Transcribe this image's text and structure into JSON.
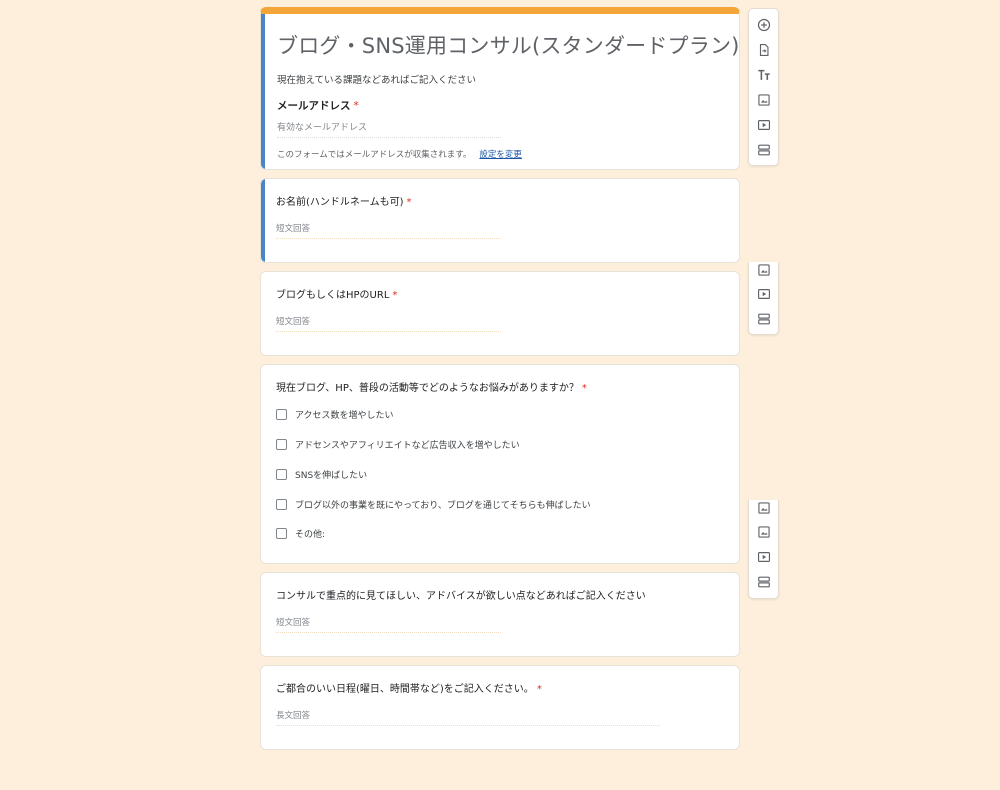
{
  "form": {
    "title": "ブログ・SNS運用コンサル(スタンダードプラン)",
    "description": "現在抱えている課題などあればご記入ください",
    "email_label": "メールアドレス",
    "required_mark": "*",
    "email_placeholder": "有効なメールアドレス",
    "collect_note": "このフォームではメールアドレスが収集されます。",
    "settings_link": "設定を変更"
  },
  "questions": [
    {
      "title": "お名前(ハンドルネームも可)",
      "required": "*",
      "answer_hint": "短文回答"
    },
    {
      "title": "ブログもしくはHPのURL",
      "required": "*",
      "answer_hint": "短文回答"
    },
    {
      "title": "現在ブログ、HP、普段の活動等でどのようなお悩みがありますか？",
      "required": "*",
      "options": [
        "アクセス数を増やしたい",
        "アドセンスやアフィリエイトなど広告収入を増やしたい",
        "SNSを伸ばしたい",
        "ブログ以外の事業を既にやっており、ブログを通じてそちらも伸ばしたい",
        "その他:"
      ]
    },
    {
      "title": "コンサルで重点的に見てほしい、アドバイスが欲しい点などあればご記入ください",
      "answer_hint": "短文回答"
    },
    {
      "title": "ご都合のいい日程(曜日、時間帯など)をご記入ください。",
      "required": "*",
      "answer_hint": "長文回答"
    }
  ],
  "toolbar_icons": [
    "add-question-icon",
    "import-questions-icon",
    "add-title-icon",
    "add-image-icon",
    "add-video-icon",
    "add-section-icon"
  ],
  "colors": {
    "accent": "#f4a53a",
    "active": "#4a86c5",
    "background": "#fdefdc",
    "required": "#d93025",
    "link": "#1a56a8"
  }
}
